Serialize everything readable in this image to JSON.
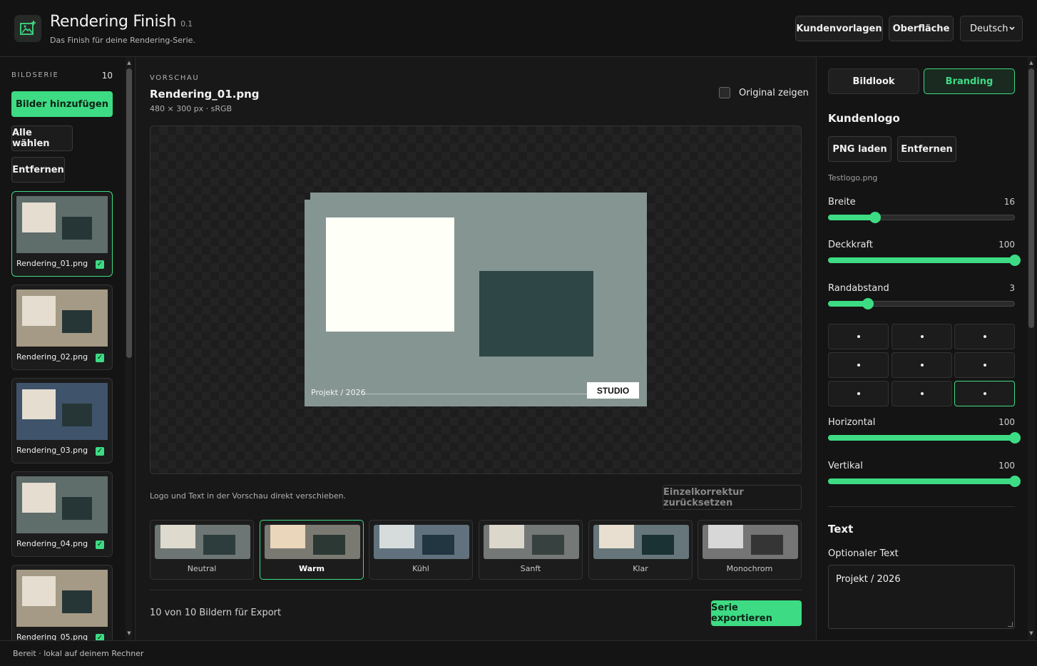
{
  "app": {
    "title": "Rendering Finish",
    "version": "0.1",
    "subtitle": "Das Finish für deine Rendering-Serie."
  },
  "header": {
    "templates_label": "Kundenvorlagen",
    "ui_label": "Oberfläche",
    "language": "Deutsch"
  },
  "sidebar": {
    "section_label": "BILDSERIE",
    "count": "10",
    "add_label": "Bilder hinzufügen",
    "select_all_label": "Alle wählen",
    "remove_label": "Entfernen",
    "thumbnails": [
      {
        "name": "Rendering_01.png",
        "bg": "#5f6d6b",
        "checked": true,
        "selected": true
      },
      {
        "name": "Rendering_02.png",
        "bg": "#a59a85",
        "checked": true,
        "selected": false
      },
      {
        "name": "Rendering_03.png",
        "bg": "#3f536a",
        "checked": true,
        "selected": false
      },
      {
        "name": "Rendering_04.png",
        "bg": "#5f6d6b",
        "checked": true,
        "selected": false
      },
      {
        "name": "Rendering_05.png",
        "bg": "#a59a85",
        "checked": true,
        "selected": false
      }
    ]
  },
  "preview": {
    "section_label": "VORSCHAU",
    "filename": "Rendering_01.png",
    "meta": "480 × 300 px · sRGB",
    "original_toggle_label": "Original zeigen",
    "original_checked": false,
    "caption_text": "Projekt / 2026",
    "logo_text": "STUDIO",
    "hint": "Logo und Text in der Vorschau direkt verschieben.",
    "reset_label": "Einzelkorrektur zurücksetzen"
  },
  "presets": [
    {
      "label": "Neutral",
      "bg": "#6d7674",
      "a": "#dfdace",
      "b": "#2d3d3e",
      "active": false
    },
    {
      "label": "Warm",
      "bg": "#7b7a72",
      "a": "#ead6bb",
      "b": "#2c3833",
      "active": true
    },
    {
      "label": "Kühl",
      "bg": "#61727e",
      "a": "#d6dcdc",
      "b": "#213641",
      "active": false
    },
    {
      "label": "Sanft",
      "bg": "#747877",
      "a": "#dcd7cb",
      "b": "#37413f",
      "active": false
    },
    {
      "label": "Klar",
      "bg": "#66767a",
      "a": "#e8dfd0",
      "b": "#1b3234",
      "active": false
    },
    {
      "label": "Monochrom",
      "bg": "#757575",
      "a": "#d7d7d7",
      "b": "#353535",
      "active": false
    }
  ],
  "export": {
    "count_text": "10 von 10 Bildern für Export",
    "button_label": "Serie exportieren"
  },
  "right_panel": {
    "tabs": [
      {
        "label": "Bildlook",
        "active": false
      },
      {
        "label": "Branding",
        "active": true
      }
    ],
    "logo_section_title": "Kundenlogo",
    "load_png_label": "PNG laden",
    "remove_label": "Entfernen",
    "logo_filename": "Testlogo.png",
    "sliders": [
      {
        "label": "Breite",
        "value": "16",
        "fraction": 0.25
      },
      {
        "label": "Deckkraft",
        "value": "100",
        "fraction": 1.0
      },
      {
        "label": "Randabstand",
        "value": "3",
        "fraction": 0.215
      }
    ],
    "position_selected": "bottom-right",
    "offset_sliders": [
      {
        "label": "Horizontal",
        "value": "100",
        "fraction": 1.0
      },
      {
        "label": "Vertikal",
        "value": "100",
        "fraction": 1.0
      }
    ],
    "text_section_title": "Text",
    "optional_text_label": "Optionaler Text",
    "optional_text_value": "Projekt / 2026"
  },
  "status": {
    "text": "Bereit · lokal auf deinem Rechner"
  },
  "colors": {
    "accent": "#3ddc84",
    "background": "#181818",
    "panel": "#141414"
  }
}
